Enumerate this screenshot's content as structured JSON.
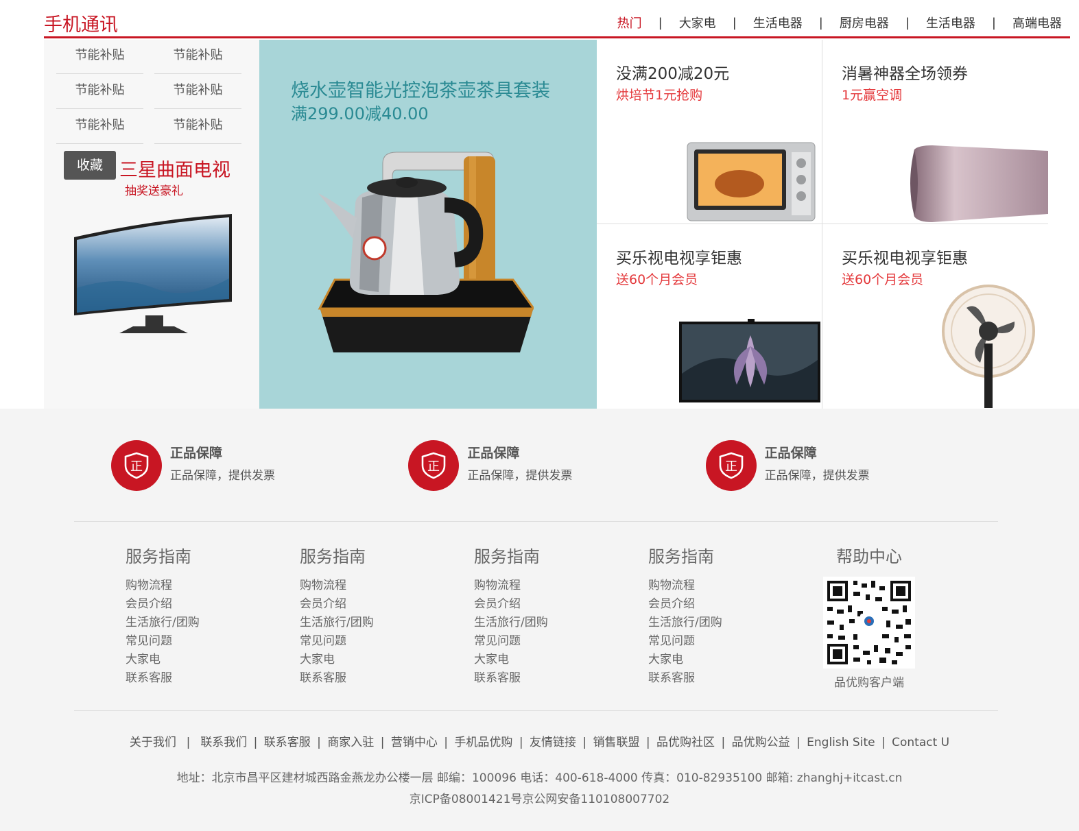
{
  "header": {
    "title": "手机通讯",
    "nav": [
      "热门",
      "大家电",
      "生活电器",
      "厨房电器",
      "生活电器",
      "高端电器"
    ],
    "nav_separator": "|",
    "accent_color": "#c81623"
  },
  "left": {
    "subsidies": [
      [
        "节能补贴",
        "节能补贴"
      ],
      [
        "节能补贴",
        "节能补贴"
      ],
      [
        "节能补贴",
        "节能补贴"
      ]
    ],
    "tv_promo": {
      "title": "三星曲面电视",
      "subtitle": "抽奖送豪礼",
      "favorite_button": "收藏"
    }
  },
  "middle": {
    "title": "烧水壶智能光控泡茶壶茶具套装",
    "subtitle": "满299.00减40.00",
    "bg_color": "#a8d5d8"
  },
  "grid": [
    {
      "title": "没满200减20元",
      "subtitle": "烘培节1元抢购",
      "image": "oven-image"
    },
    {
      "title": "消暑神器全场领券",
      "subtitle": "1元赢空调",
      "image": "air-conditioner-image"
    },
    {
      "title": "买乐视电视享钜惠",
      "subtitle": "送60个月会员",
      "image": "tv-image"
    },
    {
      "title": "买乐视电视享钜惠",
      "subtitle": "送60个月会员",
      "image": "fan-image"
    }
  ],
  "guarantees": [
    {
      "icon": "shield-icon",
      "icon_char": "正",
      "title": "正品保障",
      "desc": "正品保障，提供发票"
    },
    {
      "icon": "shield-icon",
      "icon_char": "正",
      "title": "正品保障",
      "desc": "正品保障，提供发票"
    },
    {
      "icon": "shield-icon",
      "icon_char": "正",
      "title": "正品保障",
      "desc": "正品保障，提供发票"
    }
  ],
  "guides": [
    {
      "title": "服务指南",
      "links": [
        "购物流程",
        "会员介绍",
        "生活旅行/团购",
        "常见问题",
        "大家电",
        "联系客服"
      ]
    },
    {
      "title": "服务指南",
      "links": [
        "购物流程",
        "会员介绍",
        "生活旅行/团购",
        "常见问题",
        "大家电",
        "联系客服"
      ]
    },
    {
      "title": "服务指南",
      "links": [
        "购物流程",
        "会员介绍",
        "生活旅行/团购",
        "常见问题",
        "大家电",
        "联系客服"
      ]
    },
    {
      "title": "服务指南",
      "links": [
        "购物流程",
        "会员介绍",
        "生活旅行/团购",
        "常见问题",
        "大家电",
        "联系客服"
      ]
    }
  ],
  "help": {
    "title": "帮助中心",
    "qr_caption": "品优购客户端"
  },
  "footer_links": [
    "关于我们",
    "联系我们",
    "联系客服",
    "商家入驻",
    "营销中心",
    "手机品优购",
    "友情链接",
    "销售联盟",
    "品优购社区",
    "品优购公益",
    "English Site",
    "Contact U"
  ],
  "address": "地址：北京市昌平区建材城西路金燕龙办公楼一层 邮编：100096 电话：400-618-4000 传真：010-82935100 邮箱: zhanghj+itcast.cn",
  "icp": "京ICP备08001421号京公网安备110108007702"
}
